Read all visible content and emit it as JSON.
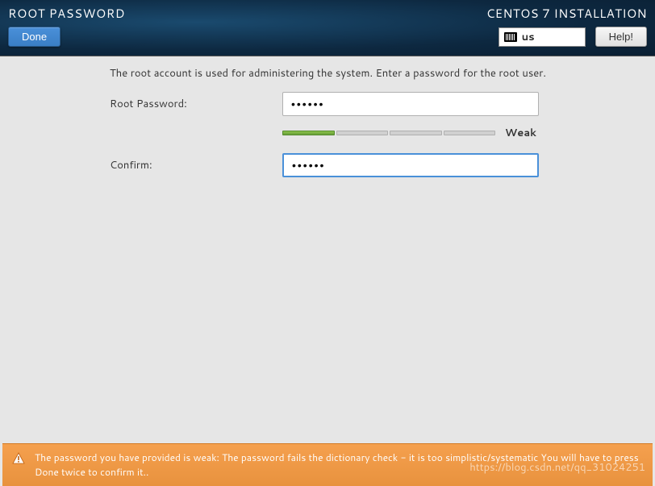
{
  "header": {
    "page_title": "ROOT PASSWORD",
    "installer_title": "CENTOS 7 INSTALLATION",
    "done_label": "Done",
    "help_label": "Help!",
    "keyboard_layout": "us"
  },
  "form": {
    "instruction": "The root account is used for administering the system.  Enter a password for the root user.",
    "password_label": "Root Password:",
    "confirm_label": "Confirm:",
    "password_value": "••••••",
    "confirm_value": "••••••",
    "strength_label": "Weak",
    "strength_level": 1,
    "strength_segments": 4
  },
  "warning": {
    "message": "The password you have provided is weak: The password fails the dictionary check - it is too simplistic/systematic You will have to press Done twice to confirm it.."
  },
  "watermark": "https://blog.csdn.net/qq_31024251"
}
